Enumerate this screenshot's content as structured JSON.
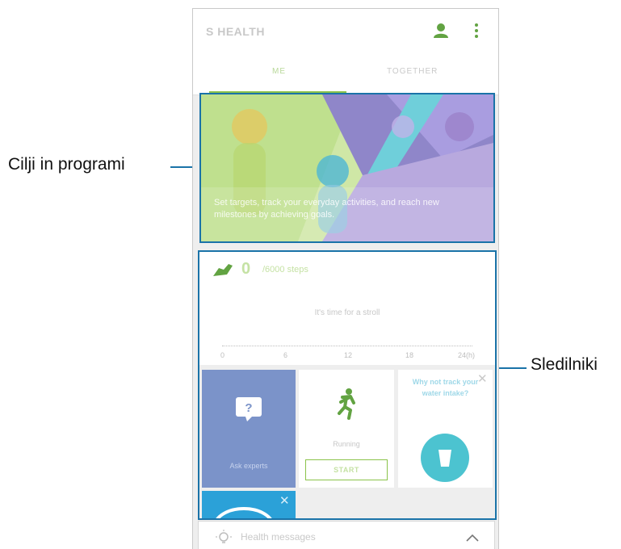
{
  "annotations": {
    "left_label": "Cilji in programi",
    "right_label": "Sledilniki"
  },
  "app": {
    "title": "S HEALTH",
    "tabs": [
      {
        "label": "ME",
        "active": true
      },
      {
        "label": "TOGETHER",
        "active": false
      }
    ]
  },
  "banner": {
    "text": "Set targets, track your everyday activities, and reach new milestones by achieving goals."
  },
  "steps": {
    "value": "0",
    "unit": "/6000 steps",
    "message": "It's time for a stroll",
    "axis_ticks": [
      "0",
      "6",
      "12",
      "18",
      "24(h)"
    ]
  },
  "tiles": {
    "ask_experts": {
      "label": "Ask experts",
      "icon": "question-bubble-icon"
    },
    "running": {
      "label": "Running",
      "button": "START",
      "icon": "runner-icon"
    },
    "water": {
      "question": "Why not track your water intake?",
      "icon": "water-glass-icon"
    }
  },
  "health_messages": {
    "label": "Health messages"
  },
  "colors": {
    "accent_green": "#8bc34a",
    "callout_blue": "#1a73a8",
    "ask_tile": "#7b93c9",
    "water_teal": "#4cc3d0",
    "bottom_tile": "#2ba1d8"
  }
}
